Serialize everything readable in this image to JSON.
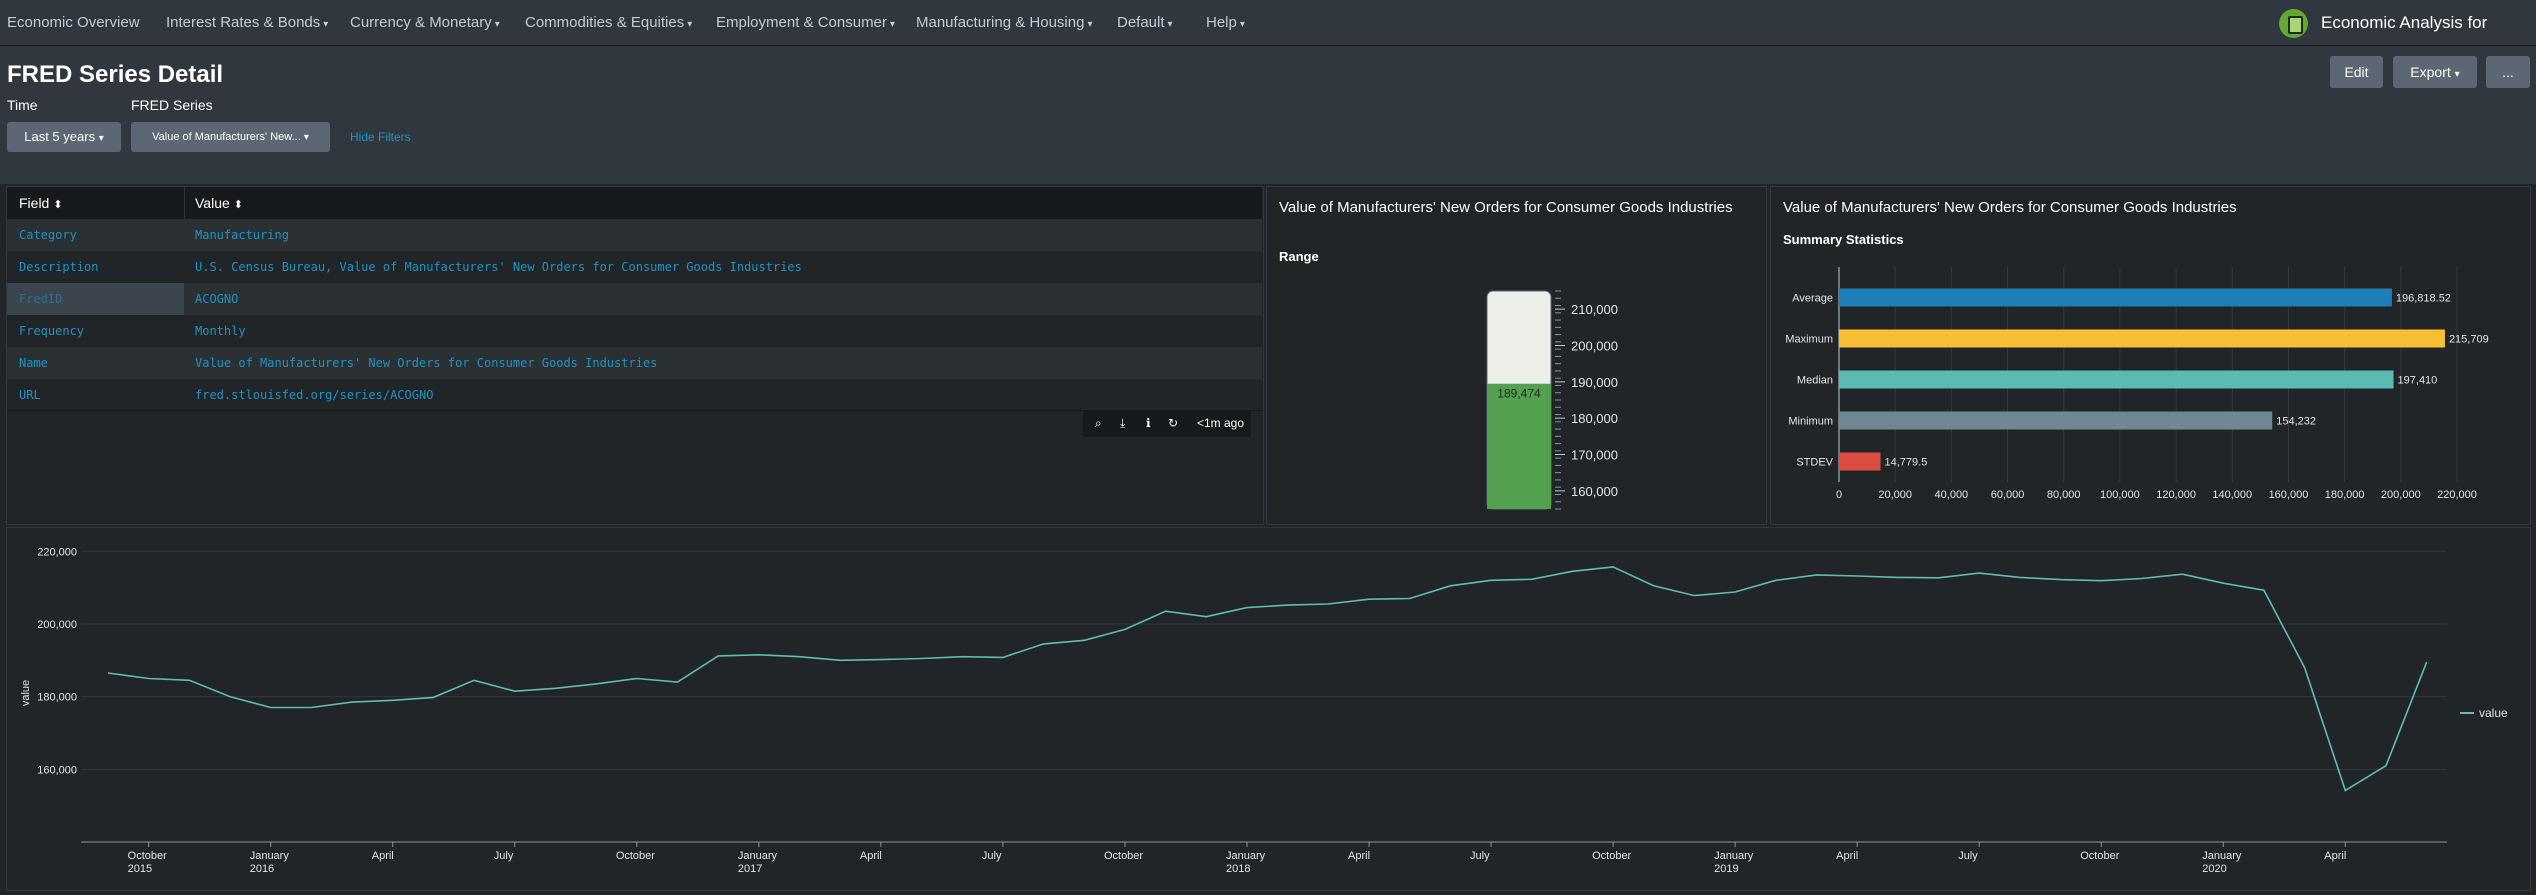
{
  "nav": {
    "items": [
      {
        "label": "Economic Overview",
        "dropdown": false
      },
      {
        "label": "Interest Rates & Bonds",
        "dropdown": true
      },
      {
        "label": "Currency & Monetary",
        "dropdown": true
      },
      {
        "label": "Commodities & Equities",
        "dropdown": true
      },
      {
        "label": "Employment & Consumer",
        "dropdown": true
      },
      {
        "label": "Manufacturing & Housing",
        "dropdown": true
      },
      {
        "label": "Default",
        "dropdown": true
      },
      {
        "label": "Help",
        "dropdown": true
      }
    ],
    "app_title": "Economic Analysis for Splunk",
    "app_icon": "calculator-icon"
  },
  "header": {
    "title": "FRED Series Detail",
    "edit_label": "Edit",
    "export_label": "Export",
    "more_label": "..."
  },
  "filters": {
    "time_label": "Time",
    "time_value": "Last 5 years",
    "series_label": "FRED Series",
    "series_value": "Value of Manufacturers' New...",
    "hide_label": "Hide Filters"
  },
  "table": {
    "headers": [
      "Field",
      "Value"
    ],
    "rows": [
      {
        "field": "Category",
        "value": "Manufacturing"
      },
      {
        "field": "Description",
        "value": "U.S. Census Bureau, Value of Manufacturers' New Orders for Consumer Goods Industries"
      },
      {
        "field": "FredID",
        "value": "ACOGNO"
      },
      {
        "field": "Frequency",
        "value": "Monthly"
      },
      {
        "field": "Name",
        "value": "Value of Manufacturers' New Orders for Consumer Goods Industries"
      },
      {
        "field": "URL",
        "value": "fred.stlouisfed.org/series/ACOGNO"
      }
    ],
    "tools_time": "<1m ago"
  },
  "colors": {
    "accent": "#1e93c6",
    "gauge_fill": "#53a051",
    "line": "#5fbcb6",
    "avg": "#1e7fb8",
    "max": "#f8be34",
    "median": "#5cbab4",
    "min": "#708794",
    "stdev": "#dc4e41"
  },
  "chart_data": [
    {
      "type": "gauge",
      "title": "Value of Manufacturers' New Orders for Consumer Goods Industries",
      "subtitle": "Range",
      "value": 189474,
      "value_label": "189,474",
      "range": [
        155000,
        215000
      ],
      "ticks": [
        "210,000",
        "200,000",
        "190,000",
        "180,000",
        "170,000",
        "160,000"
      ],
      "tick_values": [
        210000,
        200000,
        190000,
        180000,
        170000,
        160000
      ]
    },
    {
      "type": "bar",
      "orientation": "horizontal",
      "title": "Value of Manufacturers' New Orders for Consumer Goods Industries",
      "subtitle": "Summary Statistics",
      "categories": [
        "Average",
        "Maximum",
        "Median",
        "Minimum",
        "STDEV"
      ],
      "values": [
        196818.52,
        215709,
        197410,
        154232,
        14779.5
      ],
      "value_labels": [
        "196,818.52",
        "215,709",
        "197,410",
        "154,232",
        "14,779.5"
      ],
      "xlim": [
        0,
        220000
      ],
      "xticks": [
        "0",
        "20,000",
        "40,000",
        "60,000",
        "80,000",
        "100,000",
        "120,000",
        "140,000",
        "160,000",
        "180,000",
        "200,000",
        "220,000"
      ]
    },
    {
      "type": "line",
      "ylabel": "value",
      "legend": "value",
      "legend_position": "right",
      "ylim": [
        140000,
        222000
      ],
      "yticks": [
        "220,000",
        "200,000",
        "180,000",
        "160,000"
      ],
      "ytick_values": [
        220000,
        200000,
        180000,
        160000
      ],
      "xticks": [
        {
          "label": "October",
          "sub": "2015",
          "index": 1
        },
        {
          "label": "January",
          "sub": "2016",
          "index": 4
        },
        {
          "label": "April",
          "sub": "",
          "index": 7
        },
        {
          "label": "July",
          "sub": "",
          "index": 10
        },
        {
          "label": "October",
          "sub": "",
          "index": 13
        },
        {
          "label": "January",
          "sub": "2017",
          "index": 16
        },
        {
          "label": "April",
          "sub": "",
          "index": 19
        },
        {
          "label": "July",
          "sub": "",
          "index": 22
        },
        {
          "label": "October",
          "sub": "",
          "index": 25
        },
        {
          "label": "January",
          "sub": "2018",
          "index": 28
        },
        {
          "label": "April",
          "sub": "",
          "index": 31
        },
        {
          "label": "July",
          "sub": "",
          "index": 34
        },
        {
          "label": "October",
          "sub": "",
          "index": 37
        },
        {
          "label": "January",
          "sub": "2019",
          "index": 40
        },
        {
          "label": "April",
          "sub": "",
          "index": 43
        },
        {
          "label": "July",
          "sub": "",
          "index": 46
        },
        {
          "label": "October",
          "sub": "",
          "index": 49
        },
        {
          "label": "January",
          "sub": "2020",
          "index": 52
        },
        {
          "label": "April",
          "sub": "",
          "index": 55
        }
      ],
      "series": [
        {
          "name": "value",
          "values": [
            186500,
            185000,
            184500,
            180000,
            177000,
            177000,
            178500,
            179000,
            179800,
            184500,
            181500,
            182300,
            183500,
            185000,
            184000,
            191200,
            191500,
            191000,
            190000,
            190200,
            190500,
            191000,
            190800,
            194500,
            195500,
            198500,
            203500,
            202000,
            204500,
            205200,
            205500,
            206800,
            207000,
            210500,
            212000,
            212300,
            214500,
            215700,
            210500,
            207800,
            208800,
            212000,
            213500,
            213200,
            212800,
            212700,
            214000,
            212800,
            212200,
            211900,
            212500,
            213700,
            211200,
            209300,
            188000,
            154200,
            161000,
            189500
          ]
        }
      ]
    }
  ]
}
